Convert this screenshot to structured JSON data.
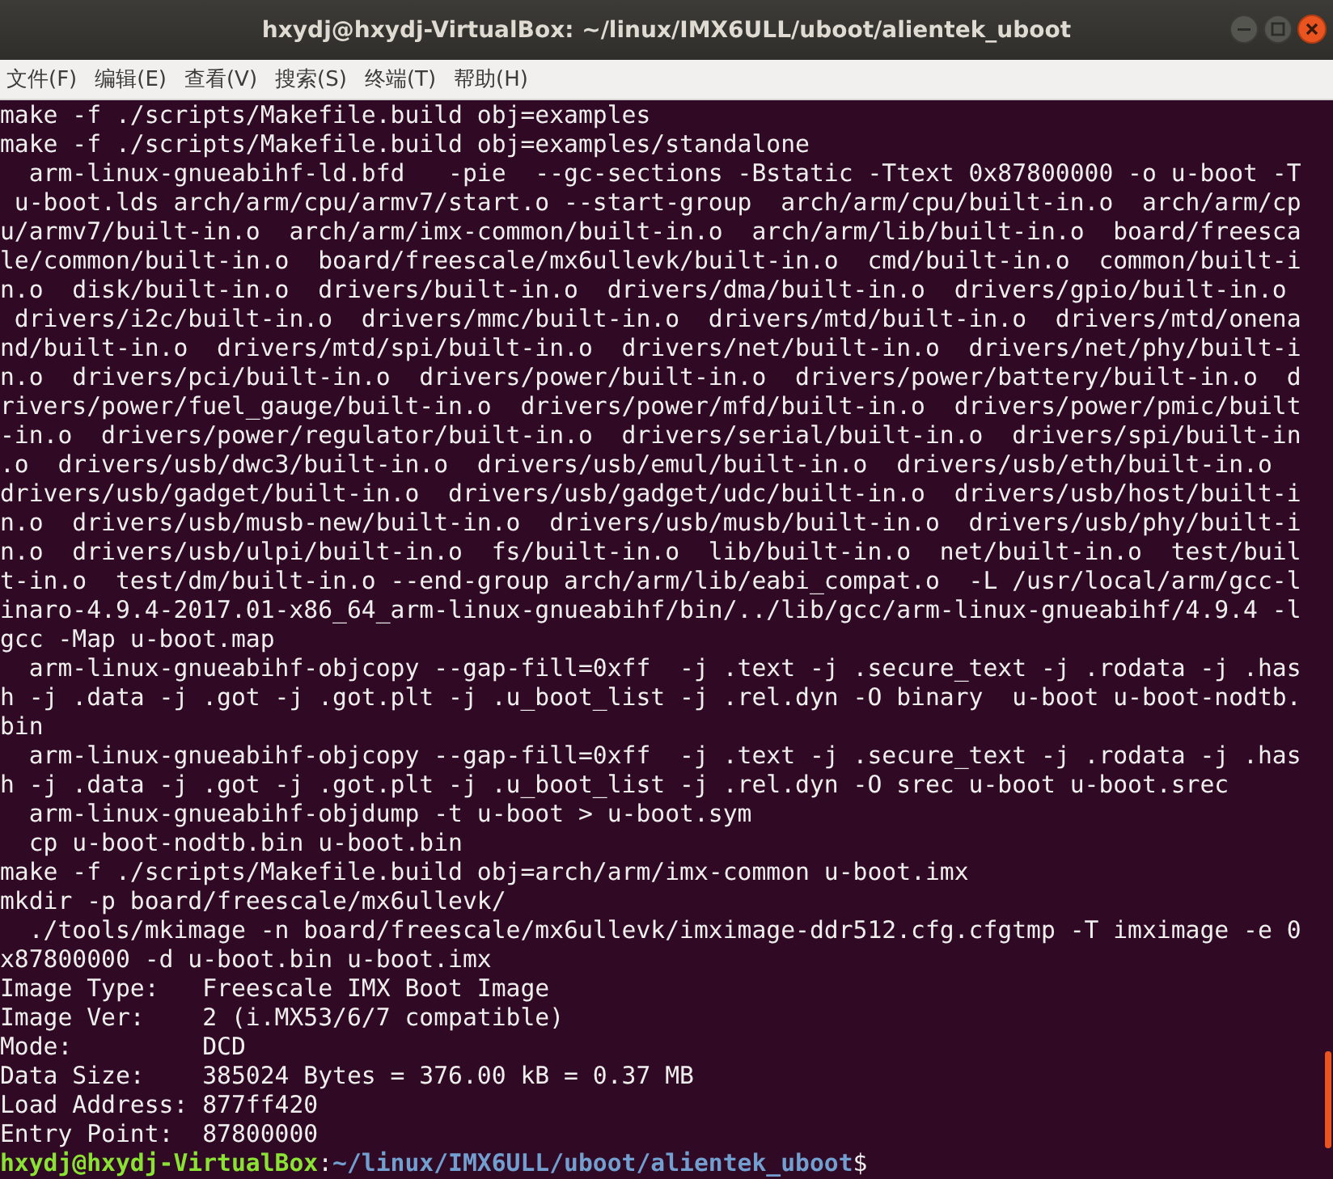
{
  "window": {
    "title": "hxydj@hxydj-VirtualBox: ~/linux/IMX6ULL/uboot/alientek_uboot"
  },
  "menu": [
    "文件(F)",
    "编辑(E)",
    "查看(V)",
    "搜索(S)",
    "终端(T)",
    "帮助(H)"
  ],
  "terminal": {
    "lines": [
      "make -f ./scripts/Makefile.build obj=examples",
      "make -f ./scripts/Makefile.build obj=examples/standalone",
      "  arm-linux-gnueabihf-ld.bfd   -pie  --gc-sections -Bstatic -Ttext 0x87800000 -o u-boot -T",
      " u-boot.lds arch/arm/cpu/armv7/start.o --start-group  arch/arm/cpu/built-in.o  arch/arm/cp",
      "u/armv7/built-in.o  arch/arm/imx-common/built-in.o  arch/arm/lib/built-in.o  board/freesca",
      "le/common/built-in.o  board/freescale/mx6ullevk/built-in.o  cmd/built-in.o  common/built-i",
      "n.o  disk/built-in.o  drivers/built-in.o  drivers/dma/built-in.o  drivers/gpio/built-in.o",
      " drivers/i2c/built-in.o  drivers/mmc/built-in.o  drivers/mtd/built-in.o  drivers/mtd/onena",
      "nd/built-in.o  drivers/mtd/spi/built-in.o  drivers/net/built-in.o  drivers/net/phy/built-i",
      "n.o  drivers/pci/built-in.o  drivers/power/built-in.o  drivers/power/battery/built-in.o  d",
      "rivers/power/fuel_gauge/built-in.o  drivers/power/mfd/built-in.o  drivers/power/pmic/built",
      "-in.o  drivers/power/regulator/built-in.o  drivers/serial/built-in.o  drivers/spi/built-in",
      ".o  drivers/usb/dwc3/built-in.o  drivers/usb/emul/built-in.o  drivers/usb/eth/built-in.o",
      "drivers/usb/gadget/built-in.o  drivers/usb/gadget/udc/built-in.o  drivers/usb/host/built-i",
      "n.o  drivers/usb/musb-new/built-in.o  drivers/usb/musb/built-in.o  drivers/usb/phy/built-i",
      "n.o  drivers/usb/ulpi/built-in.o  fs/built-in.o  lib/built-in.o  net/built-in.o  test/buil",
      "t-in.o  test/dm/built-in.o --end-group arch/arm/lib/eabi_compat.o  -L /usr/local/arm/gcc-l",
      "inaro-4.9.4-2017.01-x86_64_arm-linux-gnueabihf/bin/../lib/gcc/arm-linux-gnueabihf/4.9.4 -l",
      "gcc -Map u-boot.map",
      "  arm-linux-gnueabihf-objcopy --gap-fill=0xff  -j .text -j .secure_text -j .rodata -j .has",
      "h -j .data -j .got -j .got.plt -j .u_boot_list -j .rel.dyn -O binary  u-boot u-boot-nodtb.",
      "bin",
      "  arm-linux-gnueabihf-objcopy --gap-fill=0xff  -j .text -j .secure_text -j .rodata -j .has",
      "h -j .data -j .got -j .got.plt -j .u_boot_list -j .rel.dyn -O srec u-boot u-boot.srec",
      "  arm-linux-gnueabihf-objdump -t u-boot > u-boot.sym",
      "  cp u-boot-nodtb.bin u-boot.bin",
      "make -f ./scripts/Makefile.build obj=arch/arm/imx-common u-boot.imx",
      "mkdir -p board/freescale/mx6ullevk/",
      "  ./tools/mkimage -n board/freescale/mx6ullevk/imximage-ddr512.cfg.cfgtmp -T imximage -e 0",
      "x87800000 -d u-boot.bin u-boot.imx",
      "Image Type:   Freescale IMX Boot Image",
      "Image Ver:    2 (i.MX53/6/7 compatible)",
      "Mode:         DCD",
      "Data Size:    385024 Bytes = 376.00 kB = 0.37 MB",
      "Load Address: 877ff420",
      "Entry Point:  87800000"
    ],
    "prompt": {
      "user_host": "hxydj@hxydj-VirtualBox",
      "separator": ":",
      "path": "~/linux/IMX6ULL/uboot/alientek_uboot",
      "symbol": "$"
    }
  }
}
